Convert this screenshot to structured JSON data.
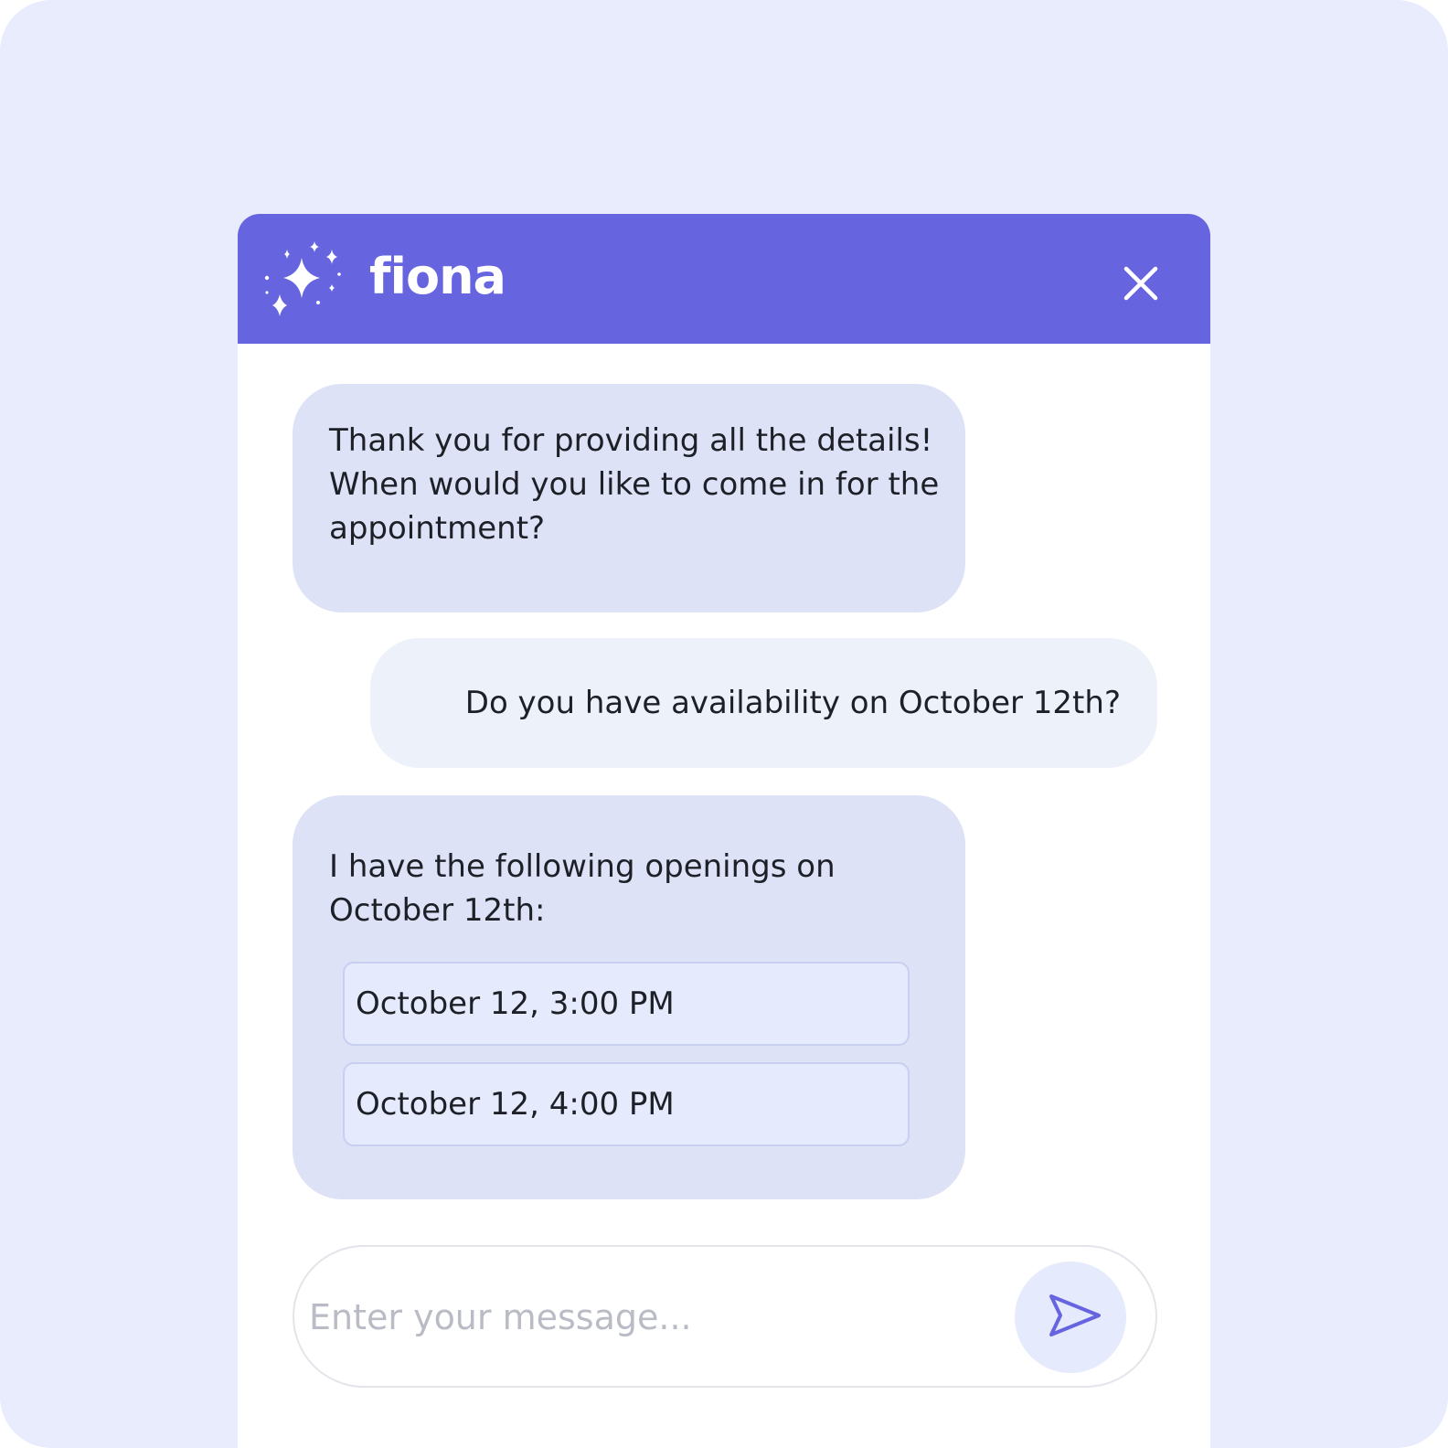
{
  "header": {
    "brand": "fiona",
    "logo_icon": "sparkle-icon",
    "close_icon": "close-icon",
    "color": "#6664df"
  },
  "messages": [
    {
      "from": "bot",
      "text": "Thank you for providing all the details! When would you like to come in for the appointment?"
    },
    {
      "from": "user",
      "text": "Do you have availability on October 12th?"
    },
    {
      "from": "bot",
      "text": "I have the following openings on October 12th:",
      "options": [
        "October 12, 3:00 PM",
        "October 12, 4:00 PM"
      ]
    }
  ],
  "composer": {
    "placeholder": "Enter your message...",
    "value": "",
    "send_icon": "send-icon"
  },
  "colors": {
    "background": "#e8ecfc",
    "bot_bubble": "#dde2f7",
    "user_bubble": "#edf1fa",
    "option_fill": "#e5eafc",
    "send_icon": "#6664df"
  }
}
